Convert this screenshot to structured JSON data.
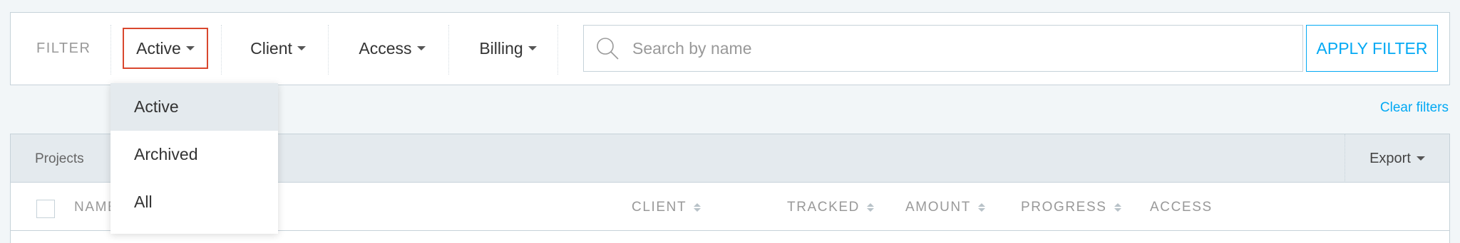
{
  "filter": {
    "label": "FILTER",
    "buttons": [
      {
        "label": "Active"
      },
      {
        "label": "Client"
      },
      {
        "label": "Access"
      },
      {
        "label": "Billing"
      }
    ],
    "search_placeholder": "Search by name",
    "apply_label": "APPLY FILTER",
    "clear_label": "Clear filters"
  },
  "dropdown": {
    "items": [
      {
        "label": "Active",
        "selected": true
      },
      {
        "label": "Archived"
      },
      {
        "label": "All"
      }
    ]
  },
  "panel": {
    "title": "Projects",
    "export_label": "Export",
    "columns": {
      "name": "NAME",
      "client": "CLIENT",
      "tracked": "TRACKED",
      "amount": "AMOUNT",
      "progress": "PROGRESS",
      "access": "ACCESS"
    }
  },
  "colors": {
    "accent": "#03a9f4",
    "highlight": "#d9472e"
  },
  "icons": {
    "search": "search-icon",
    "caret": "chevron-down-icon",
    "sort": "sort-icon"
  }
}
